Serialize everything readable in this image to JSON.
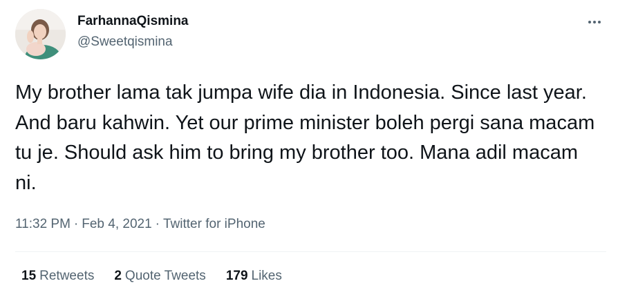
{
  "user": {
    "display_name": "FarhannaQismina",
    "handle": "@Sweetqismina",
    "avatar_icon": "profile-photo"
  },
  "more_icon": "ellipsis-icon",
  "tweet": {
    "text": "My brother lama tak jumpa wife dia in Indonesia. Since last year. And baru kahwin. Yet our prime minister boleh pergi sana macam tu je. Should ask him to bring my brother too. Mana adil macam ni."
  },
  "meta": {
    "time": "11:32 PM",
    "separator": "·",
    "date": "Feb 4, 2021",
    "source": "Twitter for iPhone"
  },
  "stats": {
    "retweets_count": "15",
    "retweets_label": "Retweets",
    "quotes_count": "2",
    "quotes_label": "Quote Tweets",
    "likes_count": "179",
    "likes_label": "Likes"
  },
  "colors": {
    "text_primary": "#0f1419",
    "text_secondary": "#536471",
    "divider": "#eff3f4"
  }
}
